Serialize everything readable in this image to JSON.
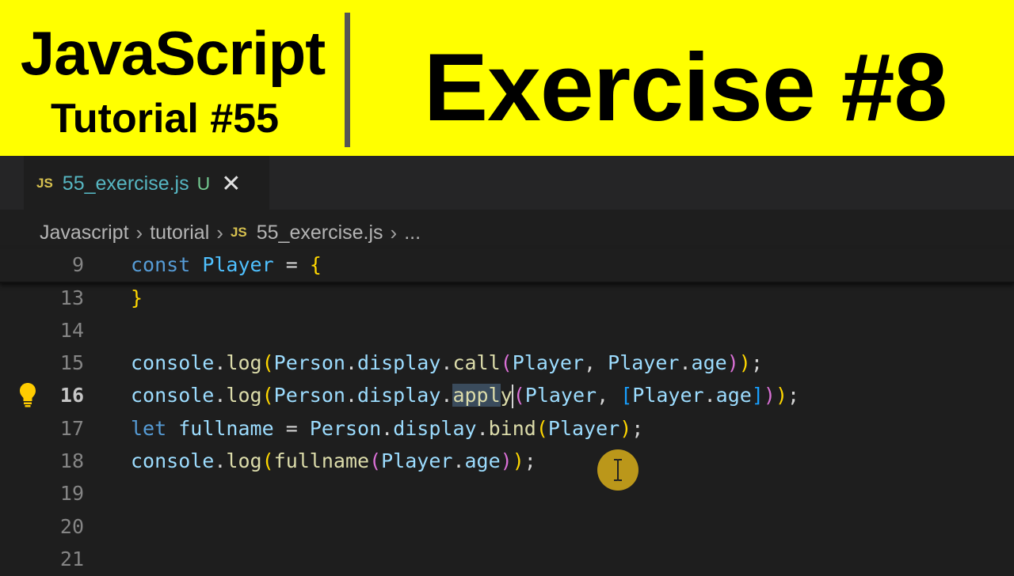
{
  "banner": {
    "left_title": "JavaScript",
    "left_subtitle": "Tutorial #55",
    "right_title": "Exercise #8",
    "background": "#ffff00"
  },
  "editor": {
    "tab": {
      "language_badge": "JS",
      "filename": "55_exercise.js",
      "status": "U",
      "close_glyph": "✕"
    },
    "breadcrumb": {
      "items": [
        "Javascript",
        "tutorial",
        "55_exercise.js",
        "..."
      ],
      "file_badge": "JS",
      "separator": "›"
    },
    "active_line": "16",
    "lines": [
      {
        "n": "9",
        "text": "const Player = {"
      },
      {
        "n": "13",
        "text": "}"
      },
      {
        "n": "14",
        "text": ""
      },
      {
        "n": "15",
        "text": "console.log(Person.display.call(Player, Player.age));"
      },
      {
        "n": "16",
        "text": "console.log(Person.display.apply(Player, [Player.age]));"
      },
      {
        "n": "17",
        "text": "let fullname = Person.display.bind(Player);"
      },
      {
        "n": "18",
        "text": "console.log(fullname(Player.age));"
      },
      {
        "n": "19",
        "text": ""
      },
      {
        "n": "20",
        "text": ""
      },
      {
        "n": "21",
        "text": ""
      }
    ],
    "icons": {
      "gutter": "lightbulb-icon",
      "mouse_cursor": "text-cursor-icon"
    }
  }
}
